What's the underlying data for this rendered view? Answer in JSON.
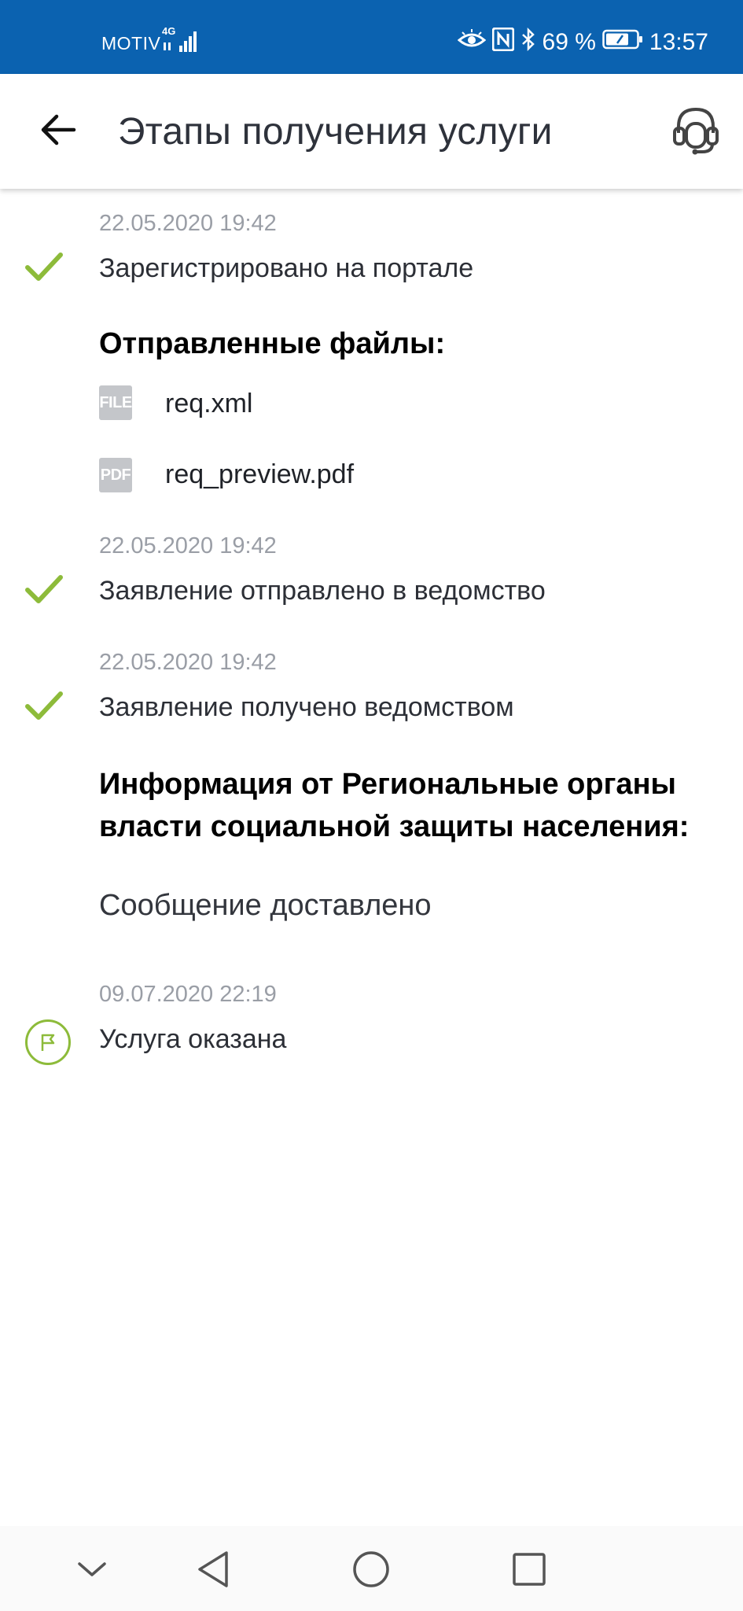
{
  "status_bar": {
    "carrier": "MOTIV",
    "network": "4G",
    "battery": "69 %",
    "time": "13:57"
  },
  "app_bar": {
    "title": "Этапы получения услуги"
  },
  "timeline": {
    "step1": {
      "date": "22.05.2020 19:42",
      "label": "Зарегистрировано на портале",
      "files_heading": "Отправленные файлы:",
      "files": [
        {
          "type": "FILE",
          "name": "req.xml"
        },
        {
          "type": "PDF",
          "name": "req_preview.pdf"
        }
      ]
    },
    "step2": {
      "date": "22.05.2020 19:42",
      "label": "Заявление отправлено в ведомство"
    },
    "step3": {
      "date": "22.05.2020 19:42",
      "label": "Заявление получено ведомством",
      "info_heading": "Информация от Региональные органы власти социальной защиты населения:",
      "message": "Сообщение доставлено"
    },
    "step4": {
      "date": "09.07.2020 22:19",
      "label": "Услуга оказана"
    }
  },
  "colors": {
    "status_bar": "#0b62b0",
    "check_green": "#8dbb3a",
    "muted_text": "#9a9ea6"
  },
  "icons": [
    "back-arrow-icon",
    "headset-icon",
    "check-icon",
    "file-icon",
    "pdf-icon",
    "flag-icon",
    "nav-down-icon",
    "nav-back-icon",
    "nav-home-icon",
    "nav-recents-icon"
  ]
}
